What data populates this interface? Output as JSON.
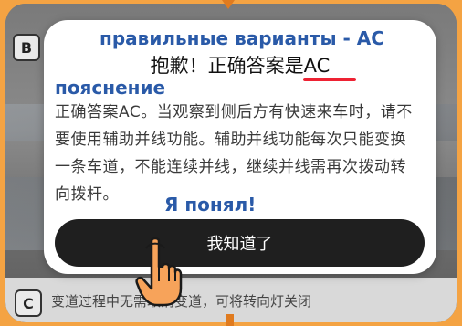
{
  "background": {
    "option_b_label": "B",
    "option_c_label": "C",
    "option_c_text": "变道过程中无需取消变道，可将转向灯关闭"
  },
  "annotation": {
    "correct_answers": "правильные варианты - АС",
    "explanation": "пояснение",
    "got_it": "Я понял!"
  },
  "dialog": {
    "title": "抱歉！正确答案是AC",
    "body": "正确答案AC。当观察到侧后方有快速来车时，请不要使用辅助并线功能。辅助并线功能每次只能变换一条车道，不能连续并线，继续并线需再次拨动转向拨杆。",
    "ok_button": "我知道了"
  },
  "colors": {
    "annotation_blue": "#2a5aa8",
    "underline_red": "#e22233",
    "arrow_orange": "#e07b1f",
    "button_bg": "#1f1f1f"
  }
}
